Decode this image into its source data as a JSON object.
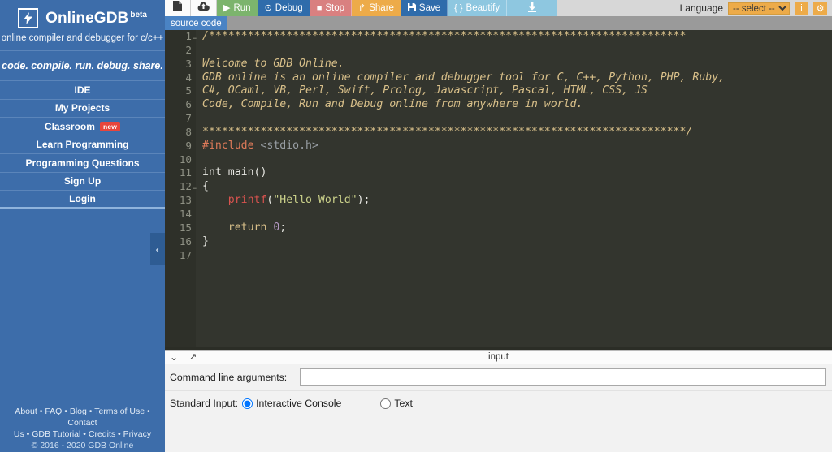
{
  "sidebar": {
    "brand": {
      "bolt_icon": "bolt-icon",
      "title": "OnlineGDB",
      "beta": "beta",
      "subtitle": "online compiler and debugger for c/c++"
    },
    "tagline": "code. compile. run. debug. share.",
    "items": [
      {
        "label": "IDE",
        "badge": ""
      },
      {
        "label": "My Projects",
        "badge": ""
      },
      {
        "label": "Classroom",
        "badge": "new"
      },
      {
        "label": "Learn Programming",
        "badge": ""
      },
      {
        "label": "Programming Questions",
        "badge": ""
      },
      {
        "label": "Sign Up",
        "badge": ""
      },
      {
        "label": "Login",
        "badge": ""
      }
    ],
    "collapse_glyph": "‹",
    "footer": {
      "line1": [
        "About",
        "FAQ",
        "Blog",
        "Terms of Use",
        "Contact"
      ],
      "line2": [
        "Us",
        "GDB Tutorial",
        "Credits",
        "Privacy"
      ],
      "separator": " • ",
      "copyright": "© 2016 - 2020 GDB Online"
    },
    "accent_color": "#3d6daa",
    "badge_color": "#e8453c"
  },
  "toolbar": {
    "new_file_icon": "new-file-icon",
    "upload_icon": "cloud-upload-icon",
    "buttons": [
      {
        "label": "Run",
        "glyph": "▶",
        "color": "#7cb46d"
      },
      {
        "label": "Debug",
        "glyph": "⊙",
        "color": "#2f6cab"
      },
      {
        "label": "Stop",
        "glyph": "■",
        "color": "#d98080"
      },
      {
        "label": "Share",
        "glyph": "↱",
        "color": "#edab49"
      },
      {
        "label": "Save",
        "glyph": "▮",
        "color": "#2f6cab"
      },
      {
        "label": "Beautify",
        "glyph": "{ }",
        "color": "#8ec7e0"
      }
    ],
    "download_icon": "download-icon",
    "language_label": "Language",
    "language_selected": "-- select --",
    "language_options": [
      "-- select --"
    ],
    "info_glyph": "i",
    "settings_glyph": "⚙"
  },
  "tabs": [
    {
      "label": "source code",
      "active": true
    }
  ],
  "editor": {
    "total_lines": 17,
    "fold_lines": [
      1,
      12
    ],
    "lines": [
      {
        "n": 1,
        "tokens": [
          {
            "t": "/**************************************************************************",
            "c": "c-comment"
          }
        ]
      },
      {
        "n": 2,
        "tokens": [
          {
            "t": "",
            "c": "c-comment"
          }
        ]
      },
      {
        "n": 3,
        "tokens": [
          {
            "t": "Welcome to GDB Online.",
            "c": "c-comment"
          }
        ]
      },
      {
        "n": 4,
        "tokens": [
          {
            "t": "GDB online is an online compiler and debugger tool for C, C++, Python, PHP, Ruby,",
            "c": "c-comment"
          }
        ]
      },
      {
        "n": 5,
        "tokens": [
          {
            "t": "C#, OCaml, VB, Perl, Swift, Prolog, Javascript, Pascal, HTML, CSS, JS",
            "c": "c-comment"
          }
        ]
      },
      {
        "n": 6,
        "tokens": [
          {
            "t": "Code, Compile, Run and Debug online from anywhere in world.",
            "c": "c-comment"
          }
        ]
      },
      {
        "n": 7,
        "tokens": [
          {
            "t": "",
            "c": "c-comment"
          }
        ]
      },
      {
        "n": 8,
        "tokens": [
          {
            "t": "***************************************************************************/",
            "c": "c-comment"
          }
        ]
      },
      {
        "n": 9,
        "tokens": [
          {
            "t": "#include ",
            "c": "c-pre"
          },
          {
            "t": "<stdio.h>",
            "c": "c-inc"
          }
        ]
      },
      {
        "n": 10,
        "tokens": [
          {
            "t": "",
            "c": "c-plain"
          }
        ]
      },
      {
        "n": 11,
        "tokens": [
          {
            "t": "int main()",
            "c": "c-plain"
          }
        ]
      },
      {
        "n": 12,
        "tokens": [
          {
            "t": "{",
            "c": "c-plain"
          }
        ]
      },
      {
        "n": 13,
        "tokens": [
          {
            "t": "    ",
            "c": "c-plain"
          },
          {
            "t": "printf",
            "c": "c-func"
          },
          {
            "t": "(",
            "c": "c-plain"
          },
          {
            "t": "\"Hello World\"",
            "c": "c-str"
          },
          {
            "t": ");",
            "c": "c-plain"
          }
        ]
      },
      {
        "n": 14,
        "tokens": [
          {
            "t": "",
            "c": "c-plain"
          }
        ]
      },
      {
        "n": 15,
        "tokens": [
          {
            "t": "    ",
            "c": "c-plain"
          },
          {
            "t": "return",
            "c": "c-kw"
          },
          {
            "t": " ",
            "c": "c-plain"
          },
          {
            "t": "0",
            "c": "c-num"
          },
          {
            "t": ";",
            "c": "c-plain"
          }
        ]
      },
      {
        "n": 16,
        "tokens": [
          {
            "t": "}",
            "c": "c-plain"
          }
        ]
      },
      {
        "n": 17,
        "tokens": [
          {
            "t": "",
            "c": "c-plain"
          }
        ]
      }
    ],
    "background": "#33352e",
    "gutter_background": "#2e3029"
  },
  "input_panel": {
    "title": "input",
    "collapse_glyph": "⌄",
    "expand_glyph": "↗",
    "cmdargs_label": "Command line arguments:",
    "cmdargs_value": "",
    "cmdargs_placeholder": "",
    "stdin_label": "Standard Input:",
    "options": [
      {
        "label": "Interactive Console",
        "selected": true
      },
      {
        "label": "Text",
        "selected": false
      }
    ]
  }
}
